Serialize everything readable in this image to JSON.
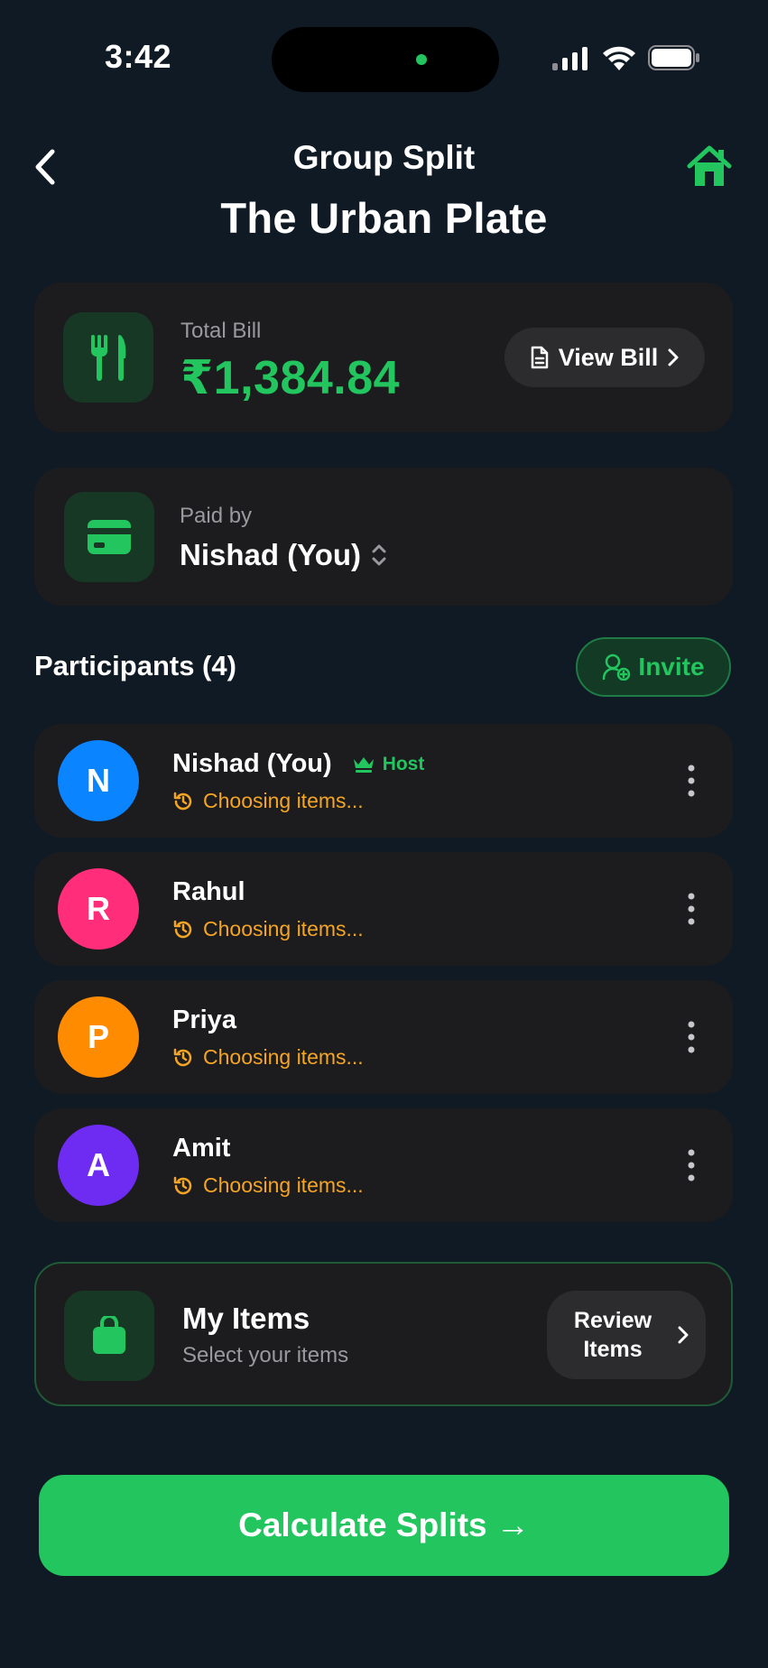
{
  "status_bar": {
    "time": "3:42"
  },
  "header": {
    "subtitle": "Group Split",
    "title": "The Urban Plate"
  },
  "bill": {
    "label": "Total Bill",
    "amount": "₹1,384.84",
    "view_label": "View Bill"
  },
  "paid_by": {
    "label": "Paid by",
    "name": "Nishad (You)"
  },
  "participants": {
    "title": "Participants (4)",
    "invite_label": "Invite",
    "host_label": "Host",
    "list": [
      {
        "initial": "N",
        "name": "Nishad (You)",
        "status": "Choosing items...",
        "color": "#0a84ff",
        "is_host": true
      },
      {
        "initial": "R",
        "name": "Rahul",
        "status": "Choosing items...",
        "color": "#ff2d7a",
        "is_host": false
      },
      {
        "initial": "P",
        "name": "Priya",
        "status": "Choosing items...",
        "color": "#ff8c00",
        "is_host": false
      },
      {
        "initial": "A",
        "name": "Amit",
        "status": "Choosing items...",
        "color": "#6e2bf2",
        "is_host": false
      }
    ]
  },
  "my_items": {
    "title": "My Items",
    "subtitle": "Select your items",
    "review_label": "Review Items"
  },
  "cta": {
    "label": "Calculate Splits →"
  },
  "colors": {
    "accent": "#22c55e",
    "status": "#f5a524",
    "card": "#1c1c1e",
    "background": "#0f1a24"
  },
  "icons": [
    "back-icon",
    "home-icon",
    "cutlery-icon",
    "document-icon",
    "chevron-right-icon",
    "card-icon",
    "sort-icon",
    "user-plus-icon",
    "crown-icon",
    "history-icon",
    "more-icon",
    "bag-icon"
  ]
}
